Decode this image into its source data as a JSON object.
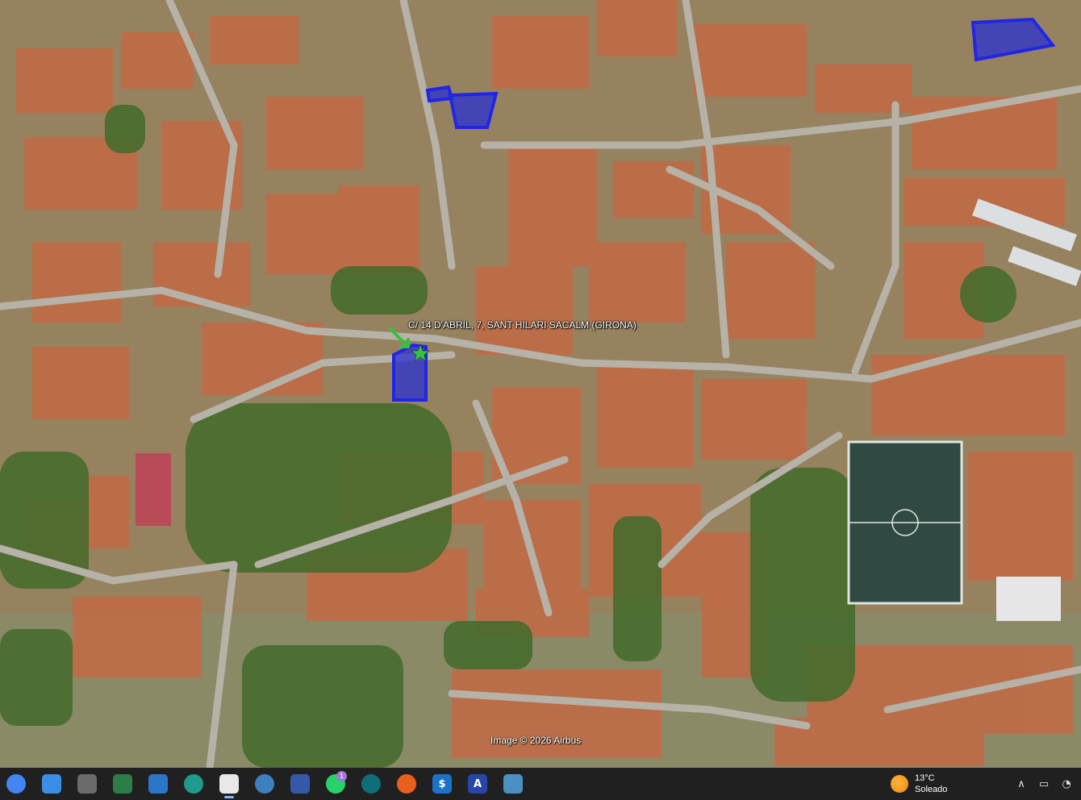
{
  "map": {
    "location_label": "C/ 14 D'ABRIL, 7, SANT HILARI SACALM (GIRONA)",
    "credit": "Image © 2026 Airbus",
    "highlight_color": "#1f26e6",
    "highlight_fill": "#2a2fd0",
    "marker_color": "#35c23b"
  },
  "taskbar": {
    "apps": [
      {
        "name": "chrome-icon",
        "glyph": "",
        "color": "#4285f4"
      },
      {
        "name": "calendar-app-icon",
        "glyph": "",
        "color": "#3a8ee6"
      },
      {
        "name": "screenshot-tool-icon",
        "glyph": "",
        "color": "#6b6b6b"
      },
      {
        "name": "secure-share-icon",
        "glyph": "",
        "color": "#2d7d46"
      },
      {
        "name": "photos-icon",
        "glyph": "",
        "color": "#2a77c9"
      },
      {
        "name": "edge-icon",
        "glyph": "",
        "color": "#1f9b8e"
      },
      {
        "name": "document-icon",
        "glyph": "",
        "color": "#e8e8e8"
      },
      {
        "name": "earth-icon",
        "glyph": "",
        "color": "#3e7fbf"
      },
      {
        "name": "save-disk-icon",
        "glyph": "",
        "color": "#3558a8"
      },
      {
        "name": "whatsapp-icon",
        "glyph": "",
        "color": "#25d366"
      },
      {
        "name": "wave-app-icon",
        "glyph": "",
        "color": "#0d6e7a"
      },
      {
        "name": "firefox-icon",
        "glyph": "",
        "color": "#e8601c"
      },
      {
        "name": "dollar-app-icon",
        "glyph": "$",
        "color": "#1a73c8"
      },
      {
        "name": "arrow-app-icon",
        "glyph": "A",
        "color": "#2747a8"
      },
      {
        "name": "window-app-icon",
        "glyph": "",
        "color": "#4a90c2"
      }
    ],
    "whatsapp_badge": "1",
    "weather": {
      "temp": "13°C",
      "condition": "Soleado"
    }
  }
}
